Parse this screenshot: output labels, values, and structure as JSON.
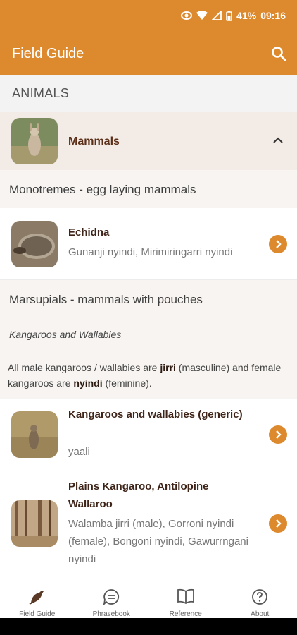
{
  "status": {
    "battery": "41%",
    "time": "09:16"
  },
  "header": {
    "title": "Field Guide"
  },
  "section": {
    "title": "ANIMALS"
  },
  "category": {
    "label": "Mammals"
  },
  "groups": {
    "monotremes": {
      "title": "Monotremes - egg laying mammals"
    },
    "marsupials": {
      "title": "Marsupials - mammals with pouches",
      "subtitle": "Kangaroos and Wallabies",
      "note_1": "All male kangaroos / wallabies are ",
      "note_b1": "jirri",
      "note_2": " (masculine) and female kangaroos are ",
      "note_b2": "nyindi",
      "note_3": " (feminine)."
    }
  },
  "items": [
    {
      "name": "Echidna",
      "sub": "Gunanji nyindi, Mirimiringarri nyindi"
    },
    {
      "name": "Kangaroos and wallabies (generic)",
      "sub": "yaali"
    },
    {
      "name": "Plains Kangaroo, Antilopine Wallaroo",
      "sub": "Walamba jirri (male), Gorroni nyindi (female), Bongoni nyindi, Gawurrngani nyindi"
    }
  ],
  "nav": [
    {
      "label": "Field Guide"
    },
    {
      "label": "Phrasebook"
    },
    {
      "label": "Reference"
    },
    {
      "label": "About"
    }
  ],
  "colors": {
    "accent": "#dd8a2e",
    "category_bg": "#f2ebe6",
    "category_text": "#5a2d16"
  }
}
